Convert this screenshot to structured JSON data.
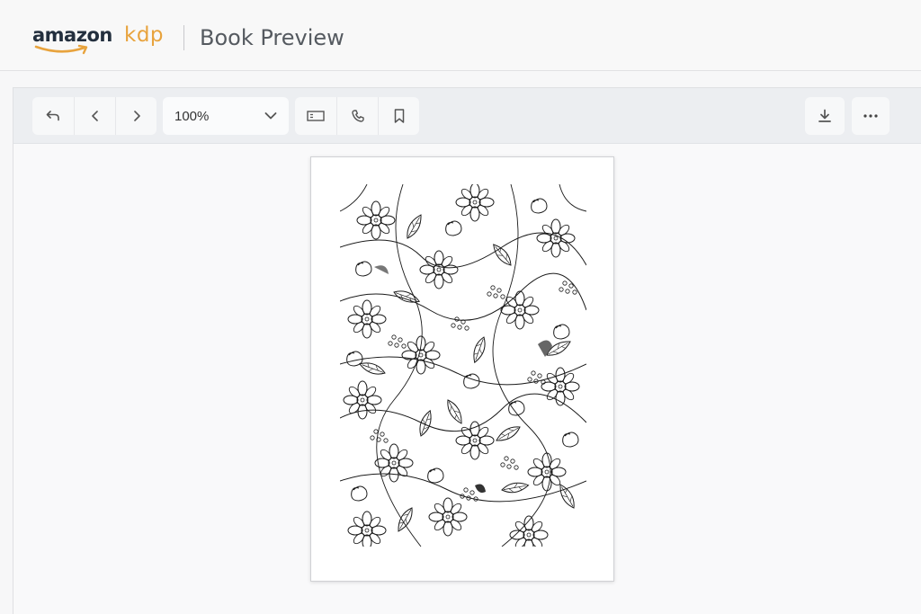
{
  "header": {
    "logo_amazon": "amazon",
    "logo_kdp": "kdp",
    "title": "Book Preview",
    "brand_color": "#e8a33d"
  },
  "toolbar": {
    "nav_icons": [
      "undo-icon",
      "chevron-left-icon",
      "chevron-right-icon"
    ],
    "zoom": {
      "value": "100%",
      "icon": "chevron-down-icon"
    },
    "view_icons": [
      "single-page-view-icon",
      "phone-view-icon",
      "bookmark-icon"
    ],
    "right_icons": [
      "download-icon",
      "more-options-icon"
    ]
  },
  "page": {
    "content": "coloring-page-illustration"
  }
}
